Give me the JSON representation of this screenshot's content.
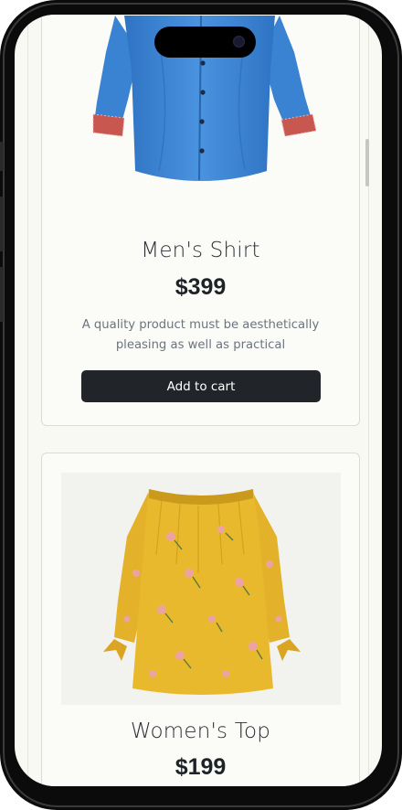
{
  "products": [
    {
      "name": "Men's Shirt",
      "price": "$399",
      "description": "A quality product must be aesthetically pleasing as well as practical",
      "button_label": "Add to cart",
      "image_icon": "blue-shirt-image",
      "colors": {
        "shirt": "#3d86d6",
        "cuff": "#c8584f"
      }
    },
    {
      "name": "Women's Top",
      "price": "$199",
      "image_icon": "yellow-floral-top-image",
      "colors": {
        "top": "#e7b829",
        "flowers": "#e8a0a0"
      }
    }
  ],
  "theme": {
    "button_bg": "#212529",
    "page_bg": "#f9f9f4"
  }
}
